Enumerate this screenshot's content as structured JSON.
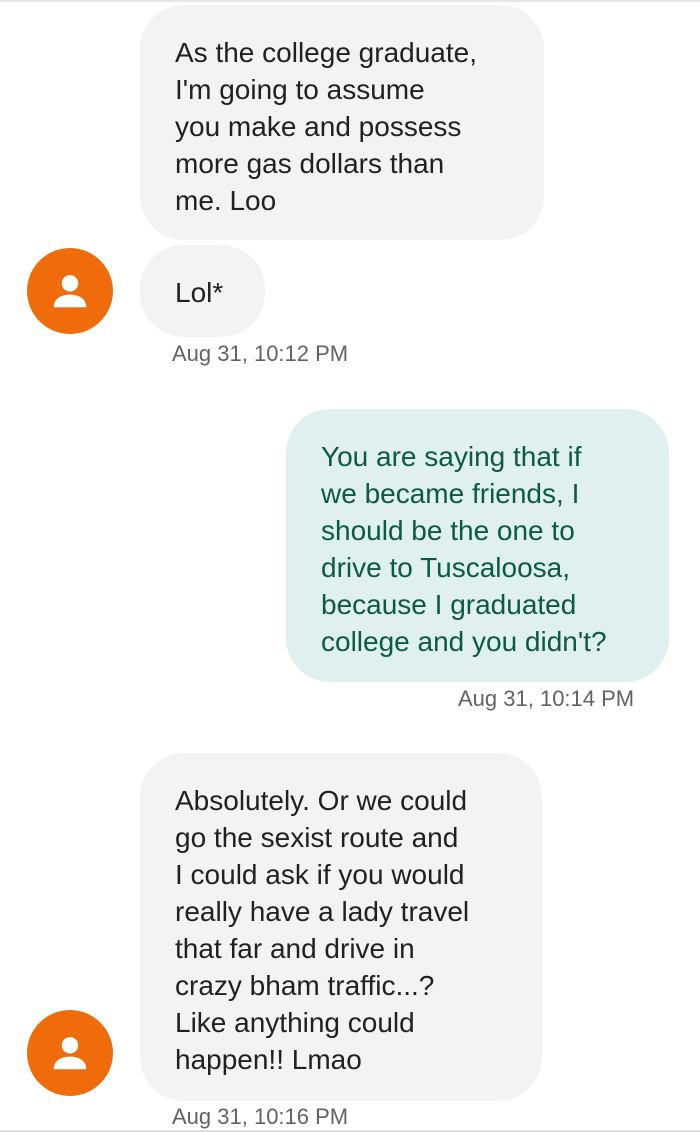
{
  "conversation": {
    "messages": [
      {
        "direction": "incoming",
        "text": "As the college graduate,\nI'm going to assume\nyou make and possess\nmore gas dollars than\nme. Loo"
      },
      {
        "direction": "incoming",
        "text": "Lol*",
        "timestamp": "Aug 31, 10:12 PM"
      },
      {
        "direction": "outgoing",
        "text": "You are saying that if\nwe became friends, I\nshould be the one to\ndrive to Tuscaloosa,\nbecause I graduated\ncollege and you didn't?",
        "timestamp": "Aug 31, 10:14 PM"
      },
      {
        "direction": "incoming",
        "text": "Absolutely. Or we could\ngo the sexist route and\nI could ask if you would\nreally have a lady travel\nthat far and drive in\ncrazy bham traffic...?\nLike anything could\nhappen!! Lmao",
        "timestamp": "Aug 31, 10:16 PM"
      }
    ]
  },
  "colors": {
    "avatar": "#f06c0a",
    "incoming_bubble": "#f1f3f4",
    "outgoing_bubble": "#dff0ee",
    "outgoing_text": "#0c5a44",
    "timestamp_text": "#5f6368"
  },
  "icons": {
    "contact_avatar": "person-icon"
  }
}
